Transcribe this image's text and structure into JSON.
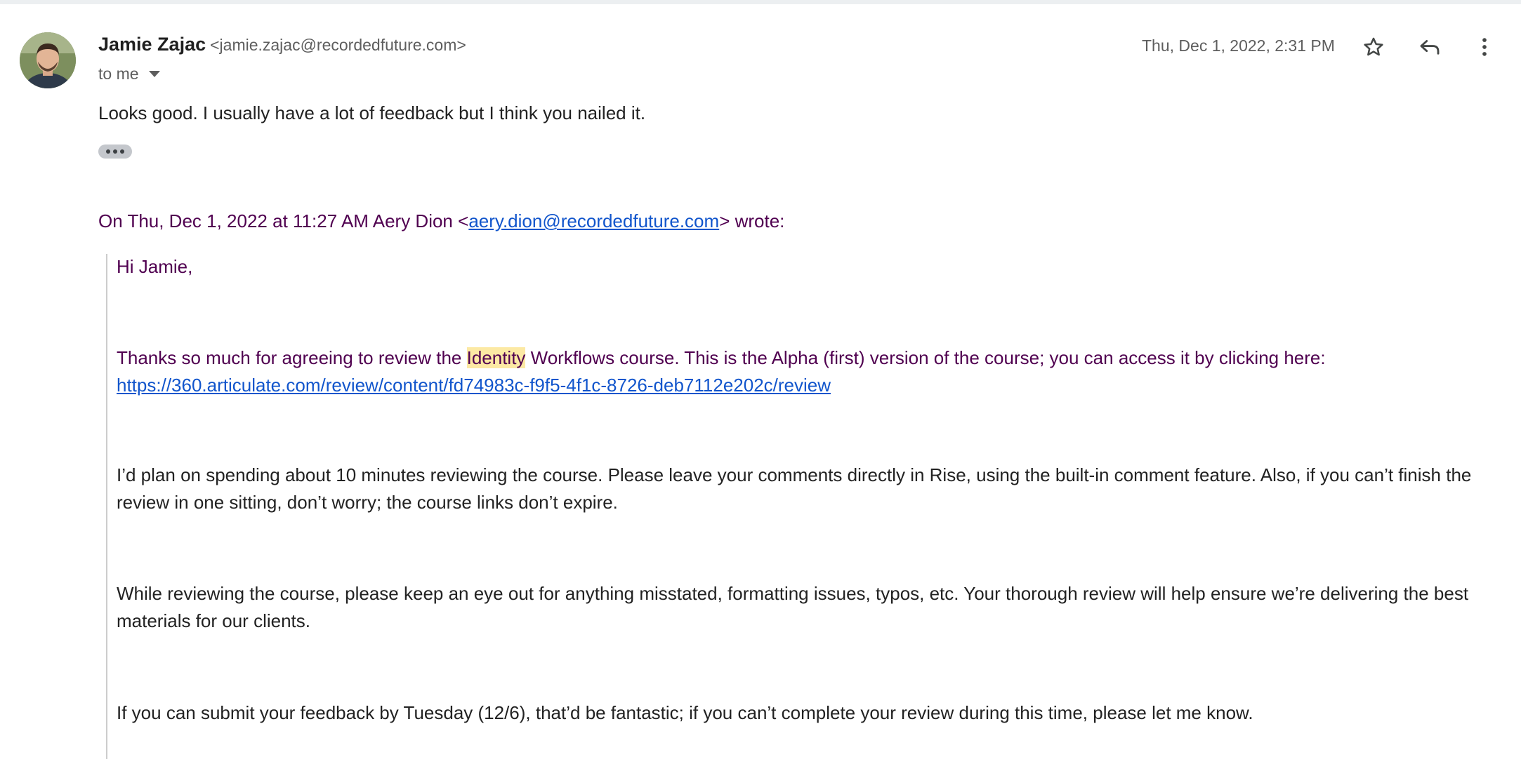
{
  "email": {
    "sender_name": "Jamie Zajac",
    "sender_email": "<jamie.zajac@recordedfuture.com>",
    "recipient_label": "to me",
    "date": "Thu, Dec 1, 2022, 2:31 PM",
    "body": "Looks good. I usually have a lot of feedback but I think you nailed it.",
    "icons": {
      "star": "star-icon",
      "reply": "reply-icon",
      "more": "more-vert-icon"
    }
  },
  "quote": {
    "header_prefix": "On Thu, Dec 1, 2022 at 11:27 AM Aery Dion <",
    "header_email": "aery.dion@recordedfuture.com",
    "header_suffix": "> wrote:",
    "greeting": "Hi Jamie,",
    "p1_before": "Thanks so much for agreeing to review the ",
    "p1_highlight": "Identity",
    "p1_after": " Workflows course. This is the Alpha (first) version of the course; you can access it by clicking here: ",
    "p1_link": "https://360.articulate.com/review/content/fd74983c-f9f5-4f1c-8726-deb7112e202c/review",
    "p2": "I’d plan on spending about 10 minutes reviewing the course. Please leave your comments directly in Rise, using the built-in comment feature. Also, if you can’t finish the review in one sitting, don’t worry; the course links don’t expire.",
    "p3": "While reviewing the course, please keep an eye out for anything misstated, formatting issues, typos, etc. Your thorough review will help ensure we’re delivering the best materials for our clients.",
    "p4": "If you can submit your feedback by Tuesday (12/6), that’d be fantastic; if you can’t complete your review during this time, please let me know."
  },
  "colors": {
    "quoted_text": "#500050",
    "link": "#1155cc",
    "highlight": "#fce9a4"
  }
}
